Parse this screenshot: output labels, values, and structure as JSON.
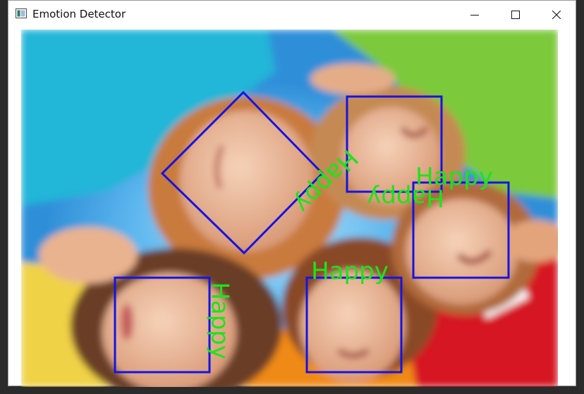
{
  "window": {
    "title": "Emotion Detector",
    "controls": [
      "minimize",
      "maximize",
      "close"
    ]
  },
  "detections": [
    {
      "label": "Happy"
    },
    {
      "label": "Happy"
    },
    {
      "label": "Happy"
    },
    {
      "label": "Happy"
    },
    {
      "label": "Happy"
    }
  ],
  "colors": {
    "box": "#1414e6",
    "label": "#19e619"
  },
  "icons": {
    "app": "app-window-icon",
    "minimize": "minimize-icon",
    "maximize": "maximize-icon",
    "close": "close-icon"
  }
}
